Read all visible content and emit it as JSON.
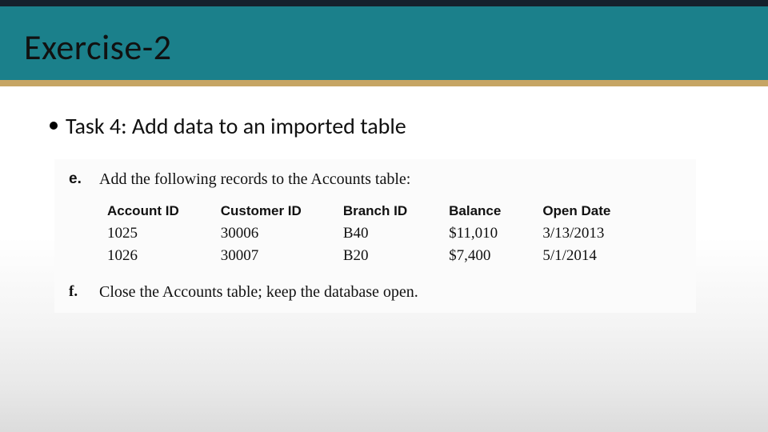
{
  "slide": {
    "title": "Exercise-2",
    "bullet": "Task 4: Add data to an imported table"
  },
  "instructions": {
    "e": {
      "marker": "e.",
      "text": "Add the following records to the Accounts table:"
    },
    "f": {
      "marker": "f.",
      "text": "Close the Accounts table; keep the database open."
    }
  },
  "table": {
    "headers": {
      "account_id": "Account ID",
      "customer_id": "Customer ID",
      "branch_id": "Branch ID",
      "balance": "Balance",
      "open_date": "Open Date"
    },
    "rows": [
      {
        "account_id": "1025",
        "customer_id": "30006",
        "branch_id": "B40",
        "balance": "$11,010",
        "open_date": "3/13/2013"
      },
      {
        "account_id": "1026",
        "customer_id": "30007",
        "branch_id": "B20",
        "balance": "$7,400",
        "open_date": "5/1/2014"
      }
    ]
  }
}
